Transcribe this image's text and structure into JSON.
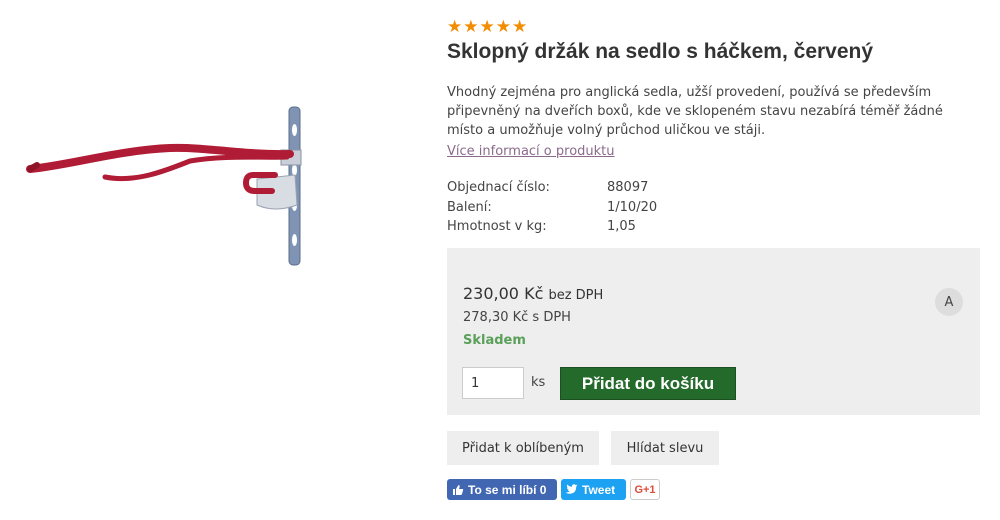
{
  "product": {
    "rating_stars": "★★★★★",
    "title": "Sklopný držák na sedlo s háčkem, červený",
    "description": "Vhodný zejména pro anglická sedla, užší provedení, používá se především připevněný na dveřích boxů, kde ve sklopeném stavu nezabírá téměř žádné místo a umožňuje volný průchod uličkou ve stáji.",
    "more_info_link": "Více informací o produktu",
    "image_icon": "saddle-rack-bracket-image",
    "image_colors": {
      "arm": "#b01b35",
      "bracket": "#7f94b5",
      "hook_plate": "#d8dce3"
    }
  },
  "specs": [
    {
      "label": "Objednací číslo:",
      "value": "88097"
    },
    {
      "label": "Balení:",
      "value": "1/10/20"
    },
    {
      "label": "Hmotnost v kg:",
      "value": "1,05"
    }
  ],
  "price": {
    "without_vat": "230,00 Kč",
    "without_vat_suffix": "bez DPH",
    "with_vat": "278,30 Kč s DPH",
    "stock_status": "Skladem",
    "quantity": "1",
    "unit": "ks",
    "add_to_cart_label": "Přidat do košíku",
    "badge": "A"
  },
  "actions": {
    "wishlist_label": "Přidat k oblíbeným",
    "price_watch_label": "Hlídat slevu"
  },
  "social": {
    "facebook_label": "To se mi líbí 0",
    "twitter_label": "Tweet",
    "gplus_label": "G+1"
  },
  "colors": {
    "accent_green": "#246a2b",
    "stock_green": "#5aa05a",
    "star_orange": "#f28c00",
    "link_purple": "#8a6b8b",
    "price_box_bg": "#eeeeee",
    "facebook_blue": "#4267b2",
    "twitter_blue": "#1da1f2",
    "gplus_red": "#dd4b39"
  }
}
